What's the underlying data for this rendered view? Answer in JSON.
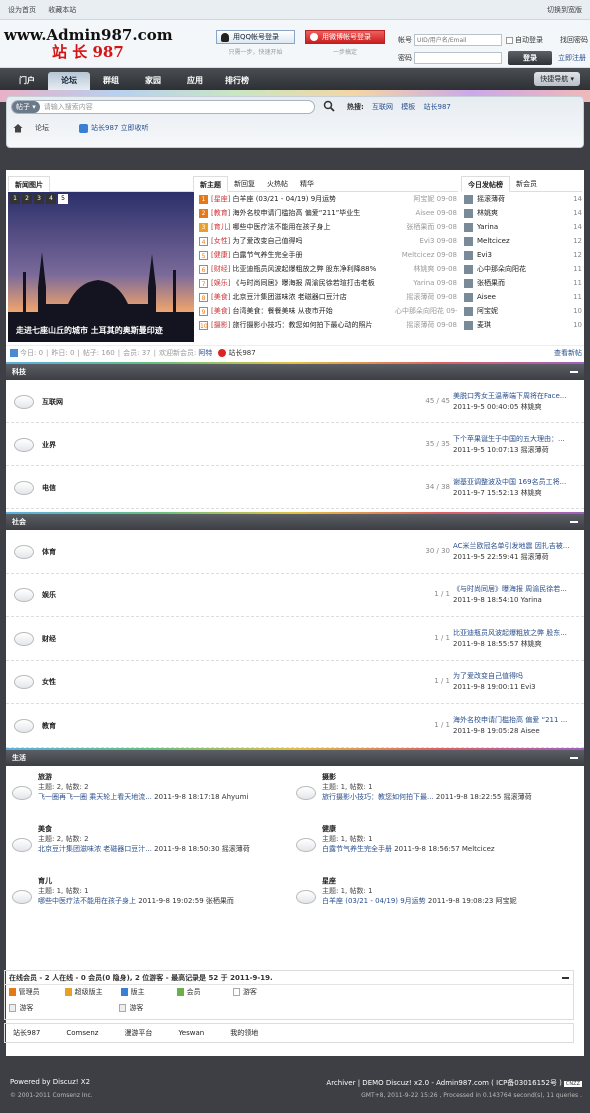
{
  "topbar": {
    "home": "设为首页",
    "fav": "收藏本站",
    "switch": "切换到宽版"
  },
  "logo": {
    "line1": "www.Admin987.com",
    "line2": "站 长 987"
  },
  "qq": {
    "label": "用QQ帐号登录",
    "sub": "只需一步，快速开始"
  },
  "weibo": {
    "label": "用微博帐号登录",
    "sub": "一步搞定"
  },
  "login": {
    "user_label": "帐号",
    "user_placeholder": "UID/用户名/Email",
    "auto": "自动登录",
    "find": "找回密码",
    "pass_label": "密码",
    "submit": "登录",
    "register": "立即注册"
  },
  "nav": {
    "items": [
      "门户",
      "论坛",
      "群组",
      "家园",
      "应用",
      "排行榜"
    ],
    "quick": "快捷导航"
  },
  "search": {
    "type": "帖子",
    "placeholder": "请输入搜索内容",
    "hot_label": "热搜:",
    "hot": [
      "互联网",
      "模板",
      "站长987"
    ]
  },
  "crumb": {
    "text": "论坛",
    "follow": "站长987 立即收听"
  },
  "tabs": {
    "pic": "新闻图片",
    "t1": "新主题",
    "t2": "新回复",
    "t3": "火热帖",
    "t4": "精华",
    "r1": "今日发帖榜",
    "r2": "新会员"
  },
  "slide": {
    "nums": [
      "1",
      "2",
      "3",
      "4",
      "5"
    ],
    "caption": "走进七座山丘的城市 土耳其的奥斯曼印迹"
  },
  "posts": [
    {
      "n": "1",
      "cat": "[星座]",
      "t": "白羊座 (03/21 - 04/19) 9月运势",
      "a": "阿宝妮",
      "d": "09-08"
    },
    {
      "n": "2",
      "cat": "[教育]",
      "t": "海外名校申请门槛抬高 偏爱“211”毕业生",
      "a": "Aisee",
      "d": "09-08"
    },
    {
      "n": "3",
      "cat": "[育儿]",
      "t": "哪些中医疗法不能用在孩子身上",
      "a": "张栖果而",
      "d": "09-08"
    },
    {
      "n": "4",
      "cat": "[女性]",
      "t": "为了爱改变自己值得吗",
      "a": "Evi3",
      "d": "09-08"
    },
    {
      "n": "5",
      "cat": "[健康]",
      "t": "白露节气养生完全手册",
      "a": "Meltcicez",
      "d": "09-08"
    },
    {
      "n": "6",
      "cat": "[财经]",
      "t": "比亚迪瓶员风波起爆粗放之弊 股东净利降88%",
      "a": "林姚爽",
      "d": "09-08"
    },
    {
      "n": "7",
      "cat": "[娱乐]",
      "t": "《与时尚同居》曝海报 周渝民徐若瑄打击老板",
      "a": "Yarina",
      "d": "09-08"
    },
    {
      "n": "8",
      "cat": "[美食]",
      "t": "北京豆汁集团滋味浓 老磁器口豆汁店",
      "a": "摇滚薄荷",
      "d": "09-08"
    },
    {
      "n": "9",
      "cat": "[美食]",
      "t": "台湾美食：餐餐美味 从夜市开始",
      "a": "心中那朵向阳花",
      "d": "09-08"
    },
    {
      "n": "10",
      "cat": "[摄影]",
      "t": "旅行摄影小技巧：教您如何拍下最心动的照片",
      "a": "摇滚薄荷",
      "d": "09-08"
    }
  ],
  "rank": [
    {
      "n": "摇滚薄荷",
      "c": "14"
    },
    {
      "n": "林姚爽",
      "c": "14"
    },
    {
      "n": "Yarina",
      "c": "14"
    },
    {
      "n": "Meltcicez",
      "c": "12"
    },
    {
      "n": "Evi3",
      "c": "12"
    },
    {
      "n": "心中那朵向阳花",
      "c": "11"
    },
    {
      "n": "张栖果而",
      "c": "11"
    },
    {
      "n": "Aisee",
      "c": "11"
    },
    {
      "n": "阿宝妮",
      "c": "10"
    },
    {
      "n": "麦琪",
      "c": "10"
    }
  ],
  "stats": {
    "today": "今日: 0",
    "yest": "昨日: 0",
    "posts": "帖子: 160",
    "members": "会员: 37",
    "welcome": "欢迎新会员:",
    "new": "阿特",
    "weibo": "站长987",
    "newest": "查看新帖"
  },
  "sections": {
    "s1": "科技",
    "s2": "社会",
    "s3": "生活"
  },
  "forums1": [
    {
      "name": "互联网",
      "cnt": "45 / 45",
      "last": "美脱口秀女王温蒂端下周将在Face...",
      "by": "2011-9-5 00:40:05 林姚爽"
    },
    {
      "name": "业界",
      "cnt": "35 / 35",
      "last": "下个苹果诞生于中国的五大理由：...",
      "by": "2011-9-5 10:07:13 摇滚薄荷"
    },
    {
      "name": "电信",
      "cnt": "34 / 38",
      "last": "谢基亚调整波及中国 169名员工将...",
      "by": "2011-9-7 15:52:13 林姚爽"
    }
  ],
  "forums2": [
    {
      "name": "体育",
      "cnt": "30 / 30",
      "last": "AC米兰欧冠名单引发地震 因扎吉被...",
      "by": "2011-9-5 22:59:41 摇滚薄荷"
    },
    {
      "name": "娱乐",
      "cnt": "1 / 1",
      "last": "《与时尚同居》曝海报 周渝民徐若...",
      "by": "2011-9-8 18:54:10 Yarina"
    },
    {
      "name": "财经",
      "cnt": "1 / 1",
      "last": "比亚迪瓶员风波起爆粗放之弊 股东...",
      "by": "2011-9-8 18:55:57 林姚爽"
    },
    {
      "name": "女性",
      "cnt": "1 / 1",
      "last": "为了爱改变自己值得吗",
      "by": "2011-9-8 19:00:11 Evi3"
    },
    {
      "name": "教育",
      "cnt": "1 / 1",
      "last": "海外名校申请门槛抬高 偏爱 “211 ...",
      "by": "2011-9-8 19:05:28 Aisee"
    }
  ],
  "forums3": [
    {
      "name": "旅游",
      "meta": "主题: 2, 帖数: 2",
      "lp": "飞一圈再飞一圈 乘天轮上看天地流...",
      "lpb": "2011-9-8 18:17:18 Ahyumi"
    },
    {
      "name": "摄影",
      "meta": "主题: 1, 帖数: 1",
      "lp": "旅行摄影小技巧：教您如何拍下最...",
      "lpb": "2011-9-8 18:22:55 摇滚薄荷"
    },
    {
      "name": "美食",
      "meta": "主题: 2, 帖数: 2",
      "lp": "北京豆汁集团滋味浓 老磁器口豆汁...",
      "lpb": "2011-9-8 18:50:30 摇滚薄荷"
    },
    {
      "name": "健康",
      "meta": "主题: 1, 帖数: 1",
      "lp": "白露节气养生完全手册",
      "lpb": "2011-9-8 18:56:57 Meltcicez"
    },
    {
      "name": "育儿",
      "meta": "主题: 1, 帖数: 1",
      "lp": "哪些中医疗法不能用在孩子身上",
      "lpb": "2011-9-8 19:02:59 张栖果而"
    },
    {
      "name": "星座",
      "meta": "主题: 1, 帖数: 1",
      "lp": "白羊座 (03/21 - 04/19) 9月运势",
      "lpb": "2011-9-8 19:08:23 阿宝妮"
    }
  ],
  "online": {
    "title": "在线会员 - 2 人在线 - 0 会员(0 隐身), 2 位游客 - 最高记录是 52 于 2011-9-19.",
    "legend": [
      "管理员",
      "超级版主",
      "版主",
      "会员",
      "游客"
    ],
    "guests": [
      "游客",
      "游客"
    ],
    "colors": [
      "#e77817",
      "#e8a02a",
      "#3a7fd4",
      "#6ab04a",
      "#ccc"
    ]
  },
  "links": [
    "站长987",
    "Comsenz",
    "漫游平台",
    "Yeswan",
    "我的领地"
  ],
  "footer": {
    "powered": "Powered by Discuz! X2",
    "copy": "© 2001-2011 Comsenz Inc.",
    "right": "Archiver | DEMO Discuz! x2.0 - Admin987.com ( ICP备03016152号 )",
    "cnzz": "CNZZ",
    "time": "GMT+8, 2011-9-22 15:26 , Processed in 0.143764 second(s), 11 queries ."
  }
}
